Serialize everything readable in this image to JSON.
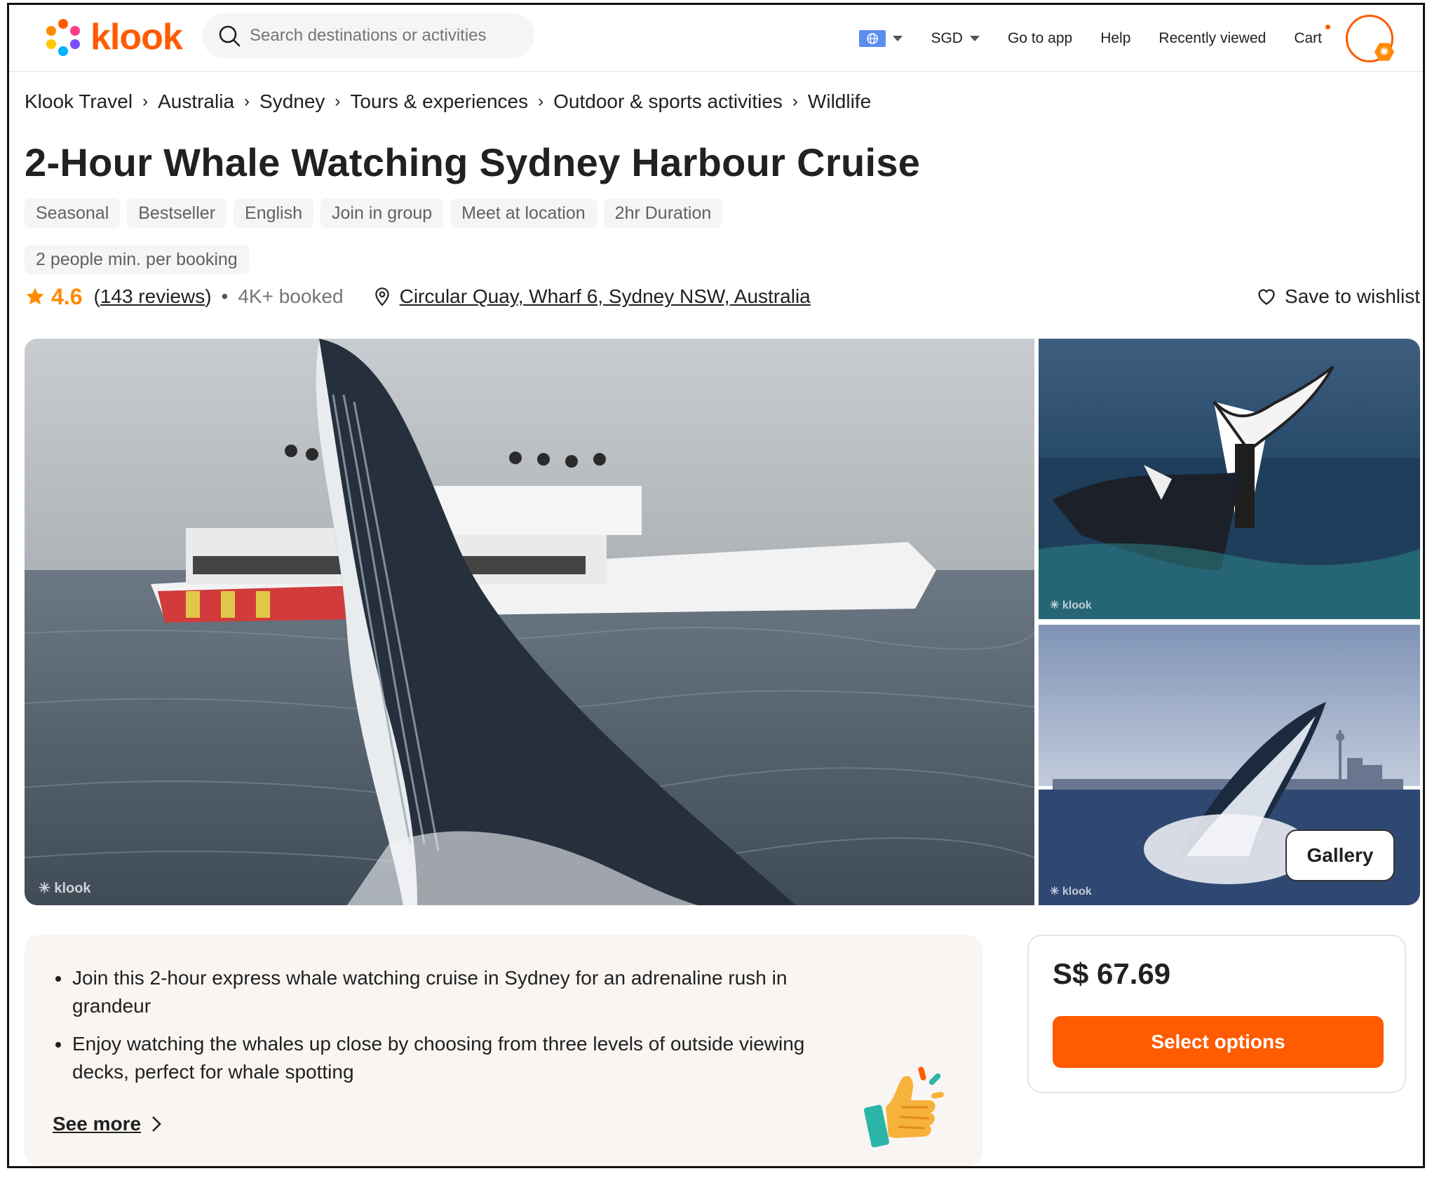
{
  "header": {
    "logo_text": "klook",
    "search_placeholder": "Search destinations or activities",
    "currency": "SGD",
    "go_to_app": "Go to app",
    "help": "Help",
    "recently_viewed": "Recently viewed",
    "cart": "Cart"
  },
  "breadcrumb": [
    "Klook Travel",
    "Australia",
    "Sydney",
    "Tours & experiences",
    "Outdoor & sports activities",
    "Wildlife"
  ],
  "title": "2-Hour Whale Watching Sydney Harbour Cruise",
  "tags": [
    "Seasonal",
    "Bestseller",
    "English",
    "Join in group",
    "Meet at location",
    "2hr Duration",
    "2 people min. per booking"
  ],
  "rating": {
    "score": "4.6",
    "reviews_open": "(",
    "reviews": "143 reviews",
    "reviews_close": ")",
    "separator": "•",
    "booked": "4K+ booked"
  },
  "location": "Circular Quay, Wharf 6, Sydney NSW, Australia",
  "wishlist": "Save to wishlist",
  "gallery": {
    "watermark": "klook",
    "button": "Gallery"
  },
  "highlights": [
    "Join this 2-hour express whale watching cruise in Sydney for an adrenaline rush in grandeur",
    "Enjoy watching the whales up close by choosing from three levels of outside viewing decks, perfect for whale spotting"
  ],
  "see_more": "See more",
  "price": "S$ 67.69",
  "select_options": "Select options",
  "colors": {
    "brand": "#ff5b00",
    "rating": "#ff8a00",
    "highlight_bg": "#f9f5f2"
  },
  "icons": [
    "klook-logo-icon",
    "search-icon",
    "globe-icon",
    "chevron-down-icon",
    "chevron-right-icon",
    "star-icon",
    "location-pin-icon",
    "heart-icon",
    "thumbs-up-icon"
  ]
}
